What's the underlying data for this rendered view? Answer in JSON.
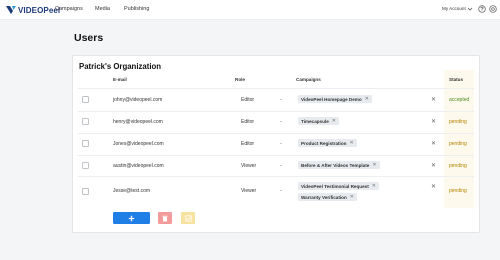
{
  "colors": {
    "accent": "#1f7fe6",
    "delete": "#f49a9a",
    "confirm": "#f7e2a0",
    "accepted": "#4f8a1e",
    "pending": "#b58200"
  },
  "nav": {
    "logo_text": "VIDEOPeel",
    "links": [
      "Campaigns",
      "Media",
      "Publishing"
    ],
    "account_label": "My Account",
    "icons": [
      "chevron-down-icon",
      "help-icon",
      "settings-icon"
    ]
  },
  "page": {
    "title": "Users"
  },
  "organization": {
    "name": "Patrick's Organization",
    "columns": {
      "email": "E-mail",
      "role": "Role",
      "campaigns": "Campaigns",
      "status": "Status"
    },
    "users": [
      {
        "email": "johny@videopeel.com",
        "role": "Editor",
        "dash": "-",
        "campaigns": [
          "VideoPeel Homepage Demo"
        ],
        "status": "accepted"
      },
      {
        "email": "henry@videopeel.com",
        "role": "Editor",
        "dash": "-",
        "campaigns": [
          "Timecapsule"
        ],
        "status": "pending"
      },
      {
        "email": "Jones@videopeel.com",
        "role": "Editor",
        "dash": "-",
        "campaigns": [
          "Product Registration"
        ],
        "status": "pending"
      },
      {
        "email": "austin@videopeel.com",
        "role": "Viewer",
        "dash": "-",
        "campaigns": [
          "Before & After Videos Template"
        ],
        "status": "pending"
      },
      {
        "email": "Jesse@test.com",
        "role": "Viewer",
        "dash": "-",
        "campaigns": [
          "VideoPeel Testimonial Request",
          "Warranty Verification"
        ],
        "status": "pending"
      }
    ]
  },
  "actions": {
    "add_icon": "plus-icon",
    "delete_icon": "trash-icon",
    "confirm_icon": "check-icon"
  }
}
